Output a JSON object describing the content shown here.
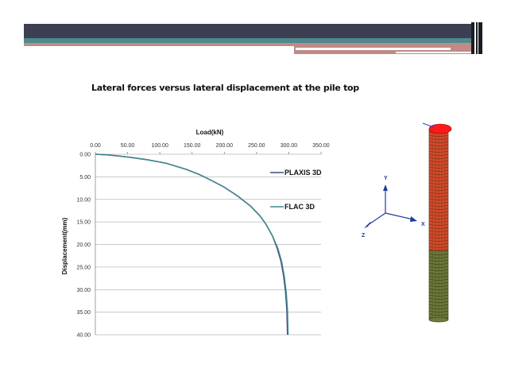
{
  "slide": {
    "title": "Lateral forces versus lateral displacement at the pile top",
    "colors": {
      "band_dark": "#3c3f52",
      "band_teal": "#4e8a8d",
      "band_rose": "#c08a86",
      "band_white": "#ffffff"
    }
  },
  "chart_data": {
    "type": "line",
    "title": "",
    "xlabel": "Load(kN)",
    "ylabel": "Displacement(mm)",
    "x_axis_position": "top",
    "y_axis_inverted": true,
    "xlim": [
      0,
      350
    ],
    "ylim": [
      0,
      40
    ],
    "x_ticks": [
      "0.00",
      "50.00",
      "100.00",
      "150.00",
      "200.00",
      "250.00",
      "300.00",
      "350.00"
    ],
    "y_ticks": [
      "0.00",
      "5.00",
      "10.00",
      "15.00",
      "20.00",
      "25.00",
      "30.00",
      "35.00",
      "40.00"
    ],
    "grid": "horizontal",
    "legend_position": "right",
    "series": [
      {
        "name": "PLAXIS 3D",
        "color": "#3e4c7e",
        "x": [
          0,
          20,
          50,
          80,
          110,
          140,
          160,
          180,
          200,
          220,
          240,
          255,
          265,
          275,
          282,
          288,
          292,
          295,
          297,
          298
        ],
        "y": [
          0,
          0.15,
          0.6,
          1.2,
          2.0,
          3.3,
          4.4,
          5.8,
          7.3,
          9.2,
          11.4,
          13.6,
          15.6,
          18.2,
          20.8,
          23.8,
          27.0,
          30.5,
          34.5,
          40.0
        ]
      },
      {
        "name": "FLAC 3D",
        "color": "#3f8a8c",
        "x": [
          0,
          20,
          50,
          80,
          110,
          140,
          160,
          180,
          200,
          220,
          240,
          255,
          265,
          275,
          283,
          289,
          293,
          296,
          298,
          299
        ],
        "y": [
          0,
          0.15,
          0.6,
          1.2,
          2.0,
          3.3,
          4.4,
          5.8,
          7.3,
          9.2,
          11.4,
          13.6,
          15.6,
          18.2,
          20.8,
          23.8,
          27.0,
          30.5,
          34.5,
          40.0
        ]
      }
    ]
  },
  "model_view": {
    "axis_labels": {
      "y": "Y",
      "x": "X",
      "z": "Z"
    },
    "colors": {
      "pile_upper": "#d84a2c",
      "pile_lower": "#6d7a3a",
      "axis": "#1f3a9a",
      "cap": "#ff1a1a"
    }
  }
}
